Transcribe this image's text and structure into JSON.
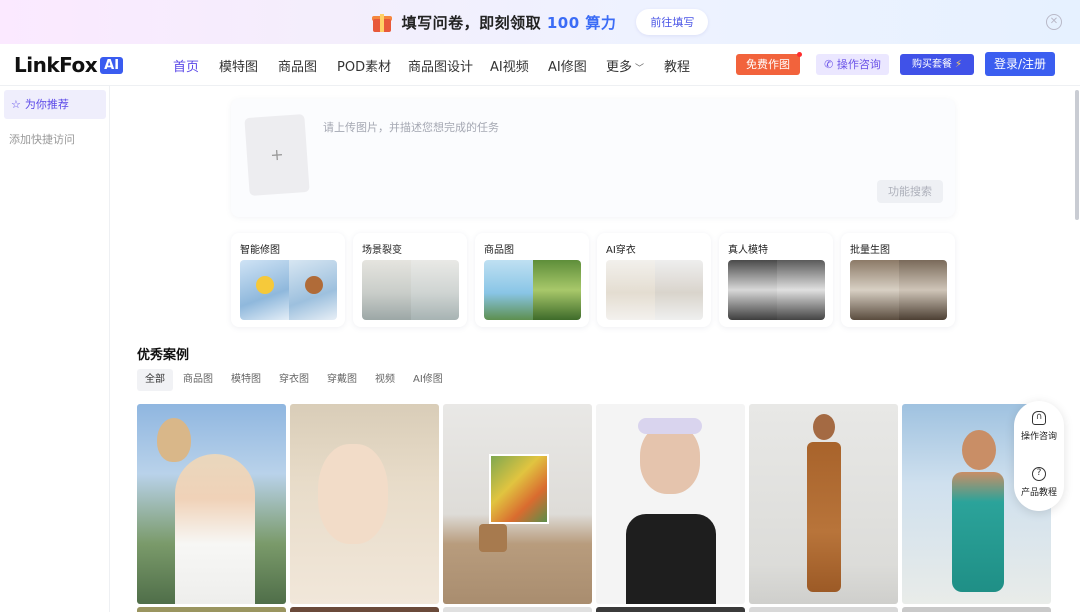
{
  "promo": {
    "text_before": "填写问卷，即刻领取 ",
    "highlight": "100 算力",
    "button": "前往填写",
    "close_icon": "close-icon"
  },
  "nav": {
    "logo_word": "LinkFox",
    "logo_badge": "AI",
    "items": [
      "首页",
      "模特图",
      "商品图",
      "POD素材",
      "商品图设计",
      "AI视频",
      "AI修图",
      "更多",
      "教程"
    ],
    "active_index": 0,
    "free_btn": "免费作图",
    "consult_btn": "操作咨询",
    "buy_btn": "购买套餐",
    "login_btn": "登录/注册"
  },
  "sidebar": {
    "recommend": "为你推荐",
    "quick_access": "添加快捷访问"
  },
  "upload": {
    "placeholder": "请上传图片，并描述您想完成的任务",
    "plus": "+",
    "search_btn": "功能搜索"
  },
  "features": [
    {
      "title": "智能修图"
    },
    {
      "title": "场景裂变"
    },
    {
      "title": "商品图"
    },
    {
      "title": "AI穿衣"
    },
    {
      "title": "真人模特"
    },
    {
      "title": "批量生图"
    }
  ],
  "cases": {
    "title": "优秀案例",
    "tabs": [
      "全部",
      "商品图",
      "模特图",
      "穿衣图",
      "穿戴图",
      "视频",
      "AI修图"
    ],
    "active_tab": 0
  },
  "float": {
    "consult": "操作咨询",
    "tutorial": "产品教程"
  },
  "colors": {
    "accent": "#5b48e8",
    "primary_blue": "#3b5ef0",
    "orange": "#f2633c"
  }
}
